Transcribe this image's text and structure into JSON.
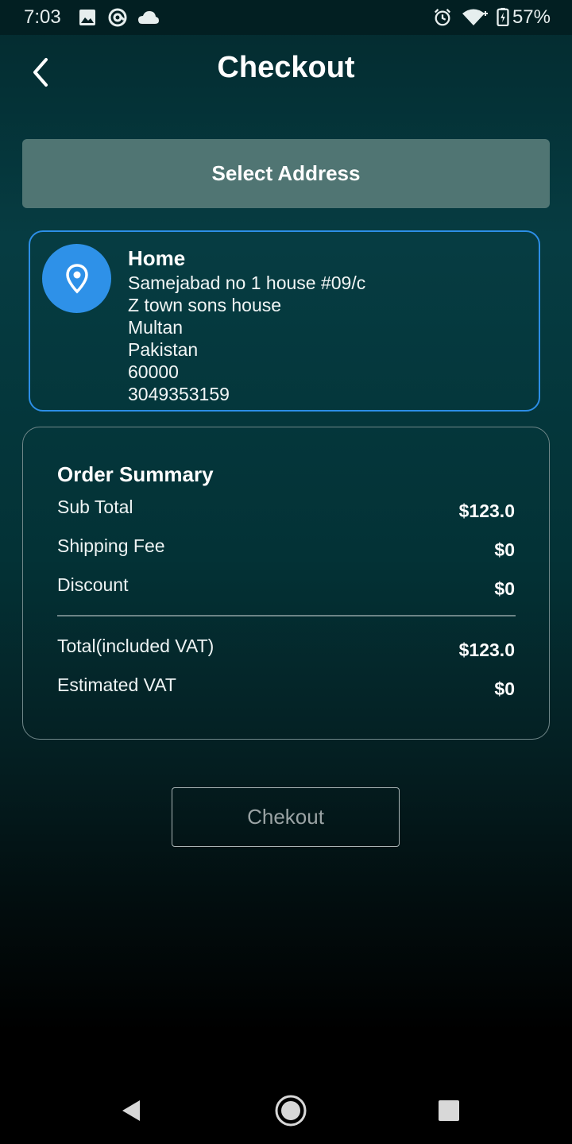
{
  "status_bar": {
    "time": "7:03",
    "battery": "57%",
    "icons": [
      "image-icon",
      "at-sign-icon",
      "cloud-icon",
      "alarm-icon",
      "wifi-icon",
      "battery-charging-icon"
    ]
  },
  "header": {
    "title": "Checkout",
    "back_icon": "chevron-left-icon"
  },
  "select_address_label": "Select Address",
  "address": {
    "icon": "location-pin-icon",
    "name": "Home",
    "lines": [
      "Samejabad no 1 house #09/c",
      "Z town sons house",
      "Multan",
      "Pakistan",
      "60000",
      "3049353159"
    ]
  },
  "order_summary": {
    "title": "Order Summary",
    "rows": [
      {
        "label": "Sub Total",
        "value": "$123.0"
      },
      {
        "label": "Shipping Fee",
        "value": "$0"
      },
      {
        "label": "Discount",
        "value": "$0"
      }
    ],
    "totals": [
      {
        "label": "Total(included VAT)",
        "value": "$123.0"
      },
      {
        "label": "Estimated VAT",
        "value": "$0"
      }
    ]
  },
  "checkout_button_label": "Chekout",
  "nav": {
    "icons": [
      "back-triangle-icon",
      "home-circle-icon",
      "recents-square-icon"
    ]
  },
  "colors": {
    "accent_blue": "#2e91e8",
    "select_address_bg": "#507573",
    "background_top": "#063c42"
  }
}
